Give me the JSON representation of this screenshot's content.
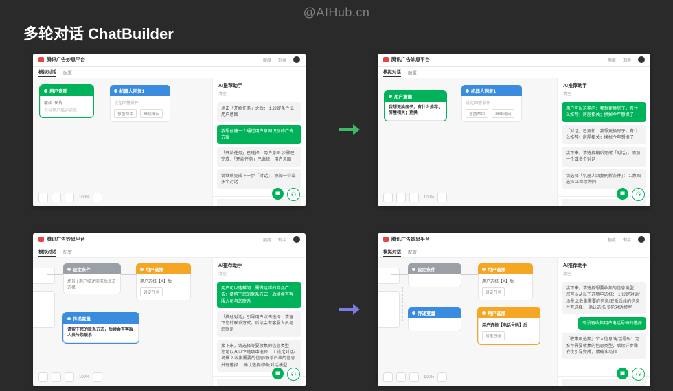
{
  "watermark": "@AIHub.cn",
  "title": "多轮对话 ChatBuilder",
  "zoom": "100%",
  "appbar": {
    "product": "腾讯广告妙思平台",
    "tab1": "模拟对话",
    "tab2": "配置",
    "credits": "额度",
    "remain": "剩余"
  },
  "sidebar_title": "AI推荐助手",
  "sidebar_sub": "清空",
  "fab": {
    "chat": "chat-icon",
    "headset": "headset-icon"
  },
  "p1": {
    "node_green_title": "用户意图",
    "node_green_items": [
      "原始: 图片",
      "引导用户描述需求"
    ],
    "node_blue_title": "机器人回复1",
    "node_blue_sub": "设定回答条件",
    "node_blue_chip1": "意图命中",
    "node_blue_chip2": "继续询问",
    "chat": [
      {
        "who": "ai",
        "text": "点击「开始任务」之后：\n1.设定条件\n2.用户意图"
      },
      {
        "who": "user",
        "text": "我想创建一个通过用户意图识别的广告方案"
      },
      {
        "who": "ai",
        "text": "「开始任务」已选择：用户意图\n步骤已完成：「开始任务」已选择：用户意图"
      },
      {
        "who": "ai",
        "text": "请继续完成下一步「对话」，添加一个或多个对话"
      }
    ]
  },
  "p2": {
    "node_green_title": "用户意图",
    "node_green_body": "我想更换房子，有什么推荐；房屋相关；更换",
    "node_blue_title": "机器人回复1",
    "node_blue_sub": "设定回答条件",
    "node_blue_chip1": "意图命中",
    "node_blue_chip2": "继续询问",
    "chat": [
      {
        "who": "user",
        "text": "用户可以这样问：我想更换房子，有什么推荐；房屋相关；换掉今年想换了"
      },
      {
        "who": "ai",
        "text": "「对话」已更新：我想更换房子，有什么推荐；房屋相关；换掉今年想换了"
      },
      {
        "who": "ai",
        "text": "接下来，请选择稍后完成「对话」，添加一个或多个对话"
      },
      {
        "who": "ai",
        "text": "请选择「机器人回复刷新条件」：\n1.意图选择\n2.继续询问"
      }
    ]
  },
  "p3": {
    "node_gray_title": "设定条件",
    "node_gray_body": "场景 | 用户描述需求后点击选择",
    "node_orange_title": "用户选择",
    "node_orange_body": "用户选择【A】后",
    "node_orange_chip": "设定任务",
    "node_blue2_title": "传递变量",
    "node_blue2_body": "请留下您的联系方式，后续会有客服人员与您联系",
    "chat": [
      {
        "who": "user",
        "text": "用户可以这样问：需做这样的商品广告；请留下您的联系方式，后续会有客服人员与您联系"
      },
      {
        "who": "ai",
        "text": "「描述对话」引导用户点击选择：请留下您的联系方式，后续会有客服人员与您联系"
      },
      {
        "who": "ai",
        "text": "接下来，请选择等要收集的信息类型，您可以从以下选项中选择：\n1.设定对话/场景\n2.收集需要的信息/联系后续的信息并有选择：\n确认选择/多轮对话模型"
      }
    ]
  },
  "p4": {
    "node_gray_title": "设定条件",
    "node_orange_title": "用户选择",
    "node_orange_body": "用户选择【A】后",
    "node_orange_chip": "设定任务",
    "node_blue2_title": "传递变量",
    "node_blue2_body": "用户选择【电话号码】后",
    "node_blue2_chip": "设定任务",
    "chat": [
      {
        "who": "ai",
        "text": "接下来，请选择想要收集的信息类型，您可以从以下选项中选择：\n1.设定对话/场景\n2.收集需要的信息/联系后续的信息并有选择：\n确认选择/多轮对话模型"
      },
      {
        "who": "user",
        "text": "有没有收集用户电话号码的选择"
      },
      {
        "who": "ai",
        "text": "「收集项选择」个人信息/电话号码：为推荐需要收集的信息类型，后续详步骤依次引导完成，请确认动作"
      }
    ]
  }
}
